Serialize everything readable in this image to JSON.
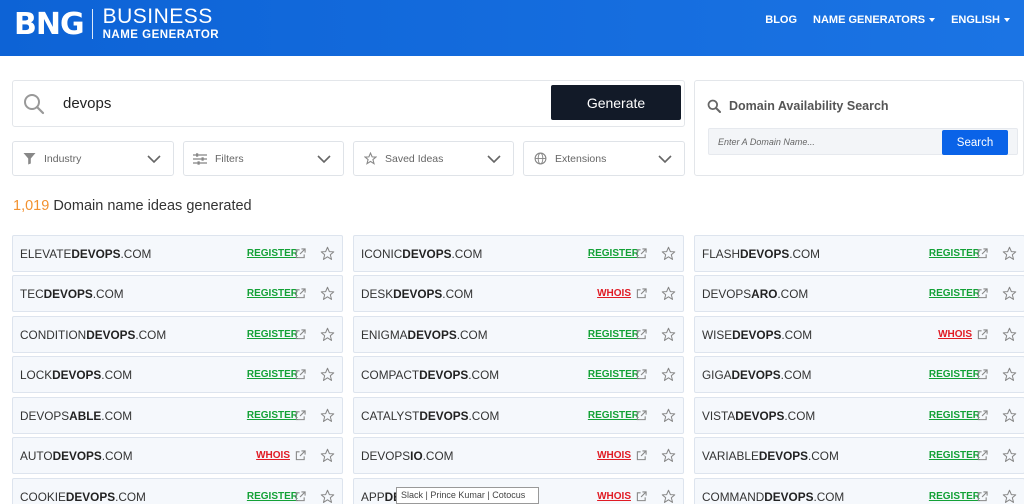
{
  "header": {
    "logo_mark": "BNG",
    "logo_line1": "BUSINESS",
    "logo_line2": "NAME GENERATOR",
    "nav": [
      {
        "label": "BLOG",
        "dropdown": false
      },
      {
        "label": "NAME GENERATORS",
        "dropdown": true
      },
      {
        "label": "ENGLISH",
        "dropdown": true
      }
    ]
  },
  "search": {
    "value": "devops",
    "button_label": "Generate"
  },
  "filters": [
    {
      "label": "Industry",
      "icon": "funnel-icon"
    },
    {
      "label": "Filters",
      "icon": "sliders-icon"
    },
    {
      "label": "Saved Ideas",
      "icon": "star-icon"
    },
    {
      "label": "Extensions",
      "icon": "globe-icon"
    }
  ],
  "availability": {
    "title": "Domain Availability Search",
    "placeholder": "Enter A Domain Name...",
    "button_label": "Search"
  },
  "results": {
    "count": "1,019",
    "label": "Domain name ideas generated"
  },
  "domains": [
    [
      {
        "pre": "ELEVATE",
        "bold": "DEVOPS",
        "post": ".COM",
        "status": "REGISTER"
      },
      {
        "pre": "TEC",
        "bold": "DEVOPS",
        "post": ".COM",
        "status": "REGISTER"
      },
      {
        "pre": "CONDITION",
        "bold": "DEVOPS",
        "post": ".COM",
        "status": "REGISTER"
      },
      {
        "pre": "LOCK",
        "bold": "DEVOPS",
        "post": ".COM",
        "status": "REGISTER"
      },
      {
        "pre": "DEVOPS",
        "bold": "ABLE",
        "post": ".COM",
        "status": "REGISTER"
      },
      {
        "pre": "AUTO",
        "bold": "DEVOPS",
        "post": ".COM",
        "status": "WHOIS"
      },
      {
        "pre": "COOKIE",
        "bold": "DEVOPS",
        "post": ".COM",
        "status": "REGISTER"
      }
    ],
    [
      {
        "pre": "ICONIC",
        "bold": "DEVOPS",
        "post": ".COM",
        "status": "REGISTER"
      },
      {
        "pre": "DESK",
        "bold": "DEVOPS",
        "post": ".COM",
        "status": "WHOIS"
      },
      {
        "pre": "ENIGMA",
        "bold": "DEVOPS",
        "post": ".COM",
        "status": "REGISTER"
      },
      {
        "pre": "COMPACT",
        "bold": "DEVOPS",
        "post": ".COM",
        "status": "REGISTER"
      },
      {
        "pre": "CATALYST",
        "bold": "DEVOPS",
        "post": ".COM",
        "status": "REGISTER"
      },
      {
        "pre": "DEVOPS",
        "bold": "IO",
        "post": ".COM",
        "status": "WHOIS"
      },
      {
        "pre": "APP",
        "bold": "DE",
        "post": "",
        "status": "WHOIS"
      }
    ],
    [
      {
        "pre": "FLASH",
        "bold": "DEVOPS",
        "post": ".COM",
        "status": "REGISTER"
      },
      {
        "pre": "DEVOPS",
        "bold": "ARO",
        "post": ".COM",
        "status": "REGISTER"
      },
      {
        "pre": "WISE",
        "bold": "DEVOPS",
        "post": ".COM",
        "status": "WHOIS"
      },
      {
        "pre": "GIGA",
        "bold": "DEVOPS",
        "post": ".COM",
        "status": "REGISTER"
      },
      {
        "pre": "VISTA",
        "bold": "DEVOPS",
        "post": ".COM",
        "status": "REGISTER"
      },
      {
        "pre": "VARIABLE",
        "bold": "DEVOPS",
        "post": ".COM",
        "status": "REGISTER"
      },
      {
        "pre": "COMMAND",
        "bold": "DEVOPS",
        "post": ".COM",
        "status": "REGISTER"
      }
    ]
  ],
  "tooltip": "Slack | Prince Kumar | Cotocus",
  "colors": {
    "header_blue": "#0d63d6",
    "generate_bg": "#121a28",
    "count_orange": "#f2912f",
    "register_green": "#13a136",
    "whois_red": "#e01b24",
    "search_blue": "#0a63e8"
  }
}
